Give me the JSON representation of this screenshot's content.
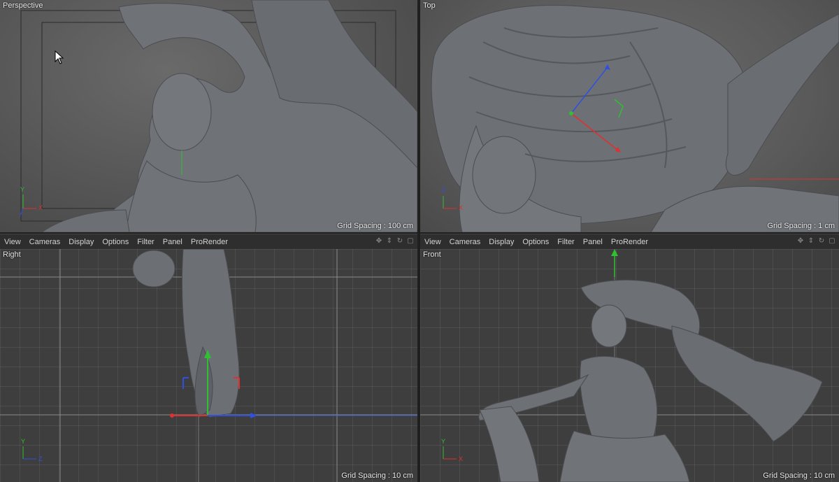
{
  "viewports": {
    "perspective": {
      "title": "Perspective",
      "grid_spacing": "Grid Spacing : 100 cm"
    },
    "top": {
      "title": "Top",
      "grid_spacing": "Grid Spacing : 1 cm"
    },
    "right": {
      "title": "Right",
      "grid_spacing": "Grid Spacing : 10 cm"
    },
    "front": {
      "title": "Front",
      "grid_spacing": "Grid Spacing : 10 cm"
    }
  },
  "menubar_left": {
    "items": [
      "View",
      "Cameras",
      "Display",
      "Options",
      "Filter",
      "Panel",
      "ProRender"
    ]
  },
  "menubar_right": {
    "items": [
      "View",
      "Cameras",
      "Display",
      "Options",
      "Filter",
      "Panel",
      "ProRender"
    ]
  },
  "axis_labels": {
    "x": "X",
    "y": "Y",
    "z": "Z"
  },
  "colors": {
    "x_axis": "#e03030",
    "y_axis": "#30c030",
    "z_axis": "#3050e0",
    "model": "#6a6d72"
  },
  "icons": {
    "viewport_controls": [
      "move-icon",
      "zoom-icon",
      "rotate-icon",
      "maximize-icon"
    ]
  }
}
